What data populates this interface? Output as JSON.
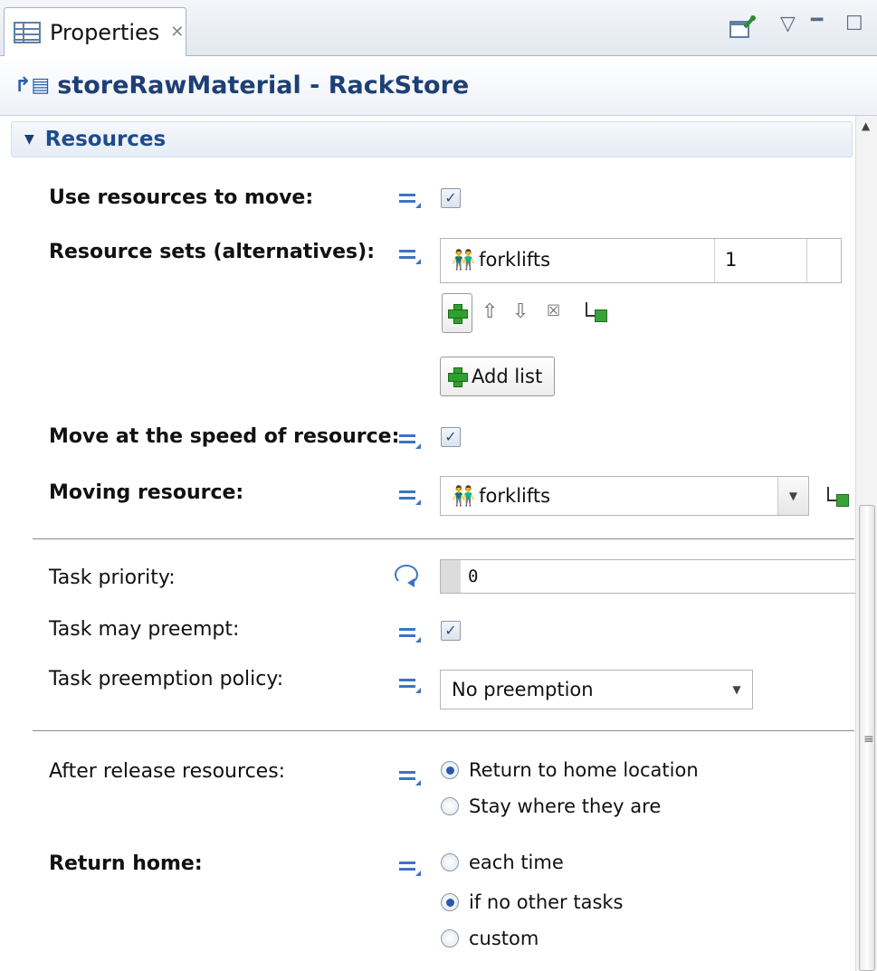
{
  "tab": {
    "label": "Properties",
    "close_glyph": "✕"
  },
  "toolbar": {
    "pin_icon": "pin-icon",
    "menu_glyph": "▽",
    "minimize_glyph": "━",
    "maximize_glyph": "☐"
  },
  "title": "storeRawMaterial - RackStore",
  "section": {
    "title": "Resources"
  },
  "fields": {
    "use_resources": {
      "label": "Use resources to move:",
      "checked": "✓"
    },
    "resource_sets": {
      "label": "Resource sets (alternatives):",
      "rows": [
        {
          "name": "forklifts",
          "quantity": "1"
        }
      ],
      "add_list_label": "Add list"
    },
    "move_speed": {
      "label": "Move at the speed of resource:",
      "checked": "✓"
    },
    "moving_resource": {
      "label": "Moving resource:",
      "value": "forklifts"
    },
    "task_priority": {
      "label": "Task priority:",
      "value": "0"
    },
    "task_preempt": {
      "label": "Task may preempt:",
      "checked": "✓"
    },
    "preemption_policy": {
      "label": "Task preemption policy:",
      "value": "No preemption"
    },
    "after_release": {
      "label": "After release resources:",
      "options": [
        "Return to home location",
        "Stay where they are"
      ],
      "selected": "Return to home location"
    },
    "return_home": {
      "label": "Return home:",
      "options": [
        "each time",
        "if no other tasks",
        "custom"
      ],
      "selected": "if no other tasks"
    }
  },
  "colors": {
    "accent": "#1d4b8f",
    "equals_icon": "#3e74c1",
    "plus_green": "#2fa02f"
  }
}
